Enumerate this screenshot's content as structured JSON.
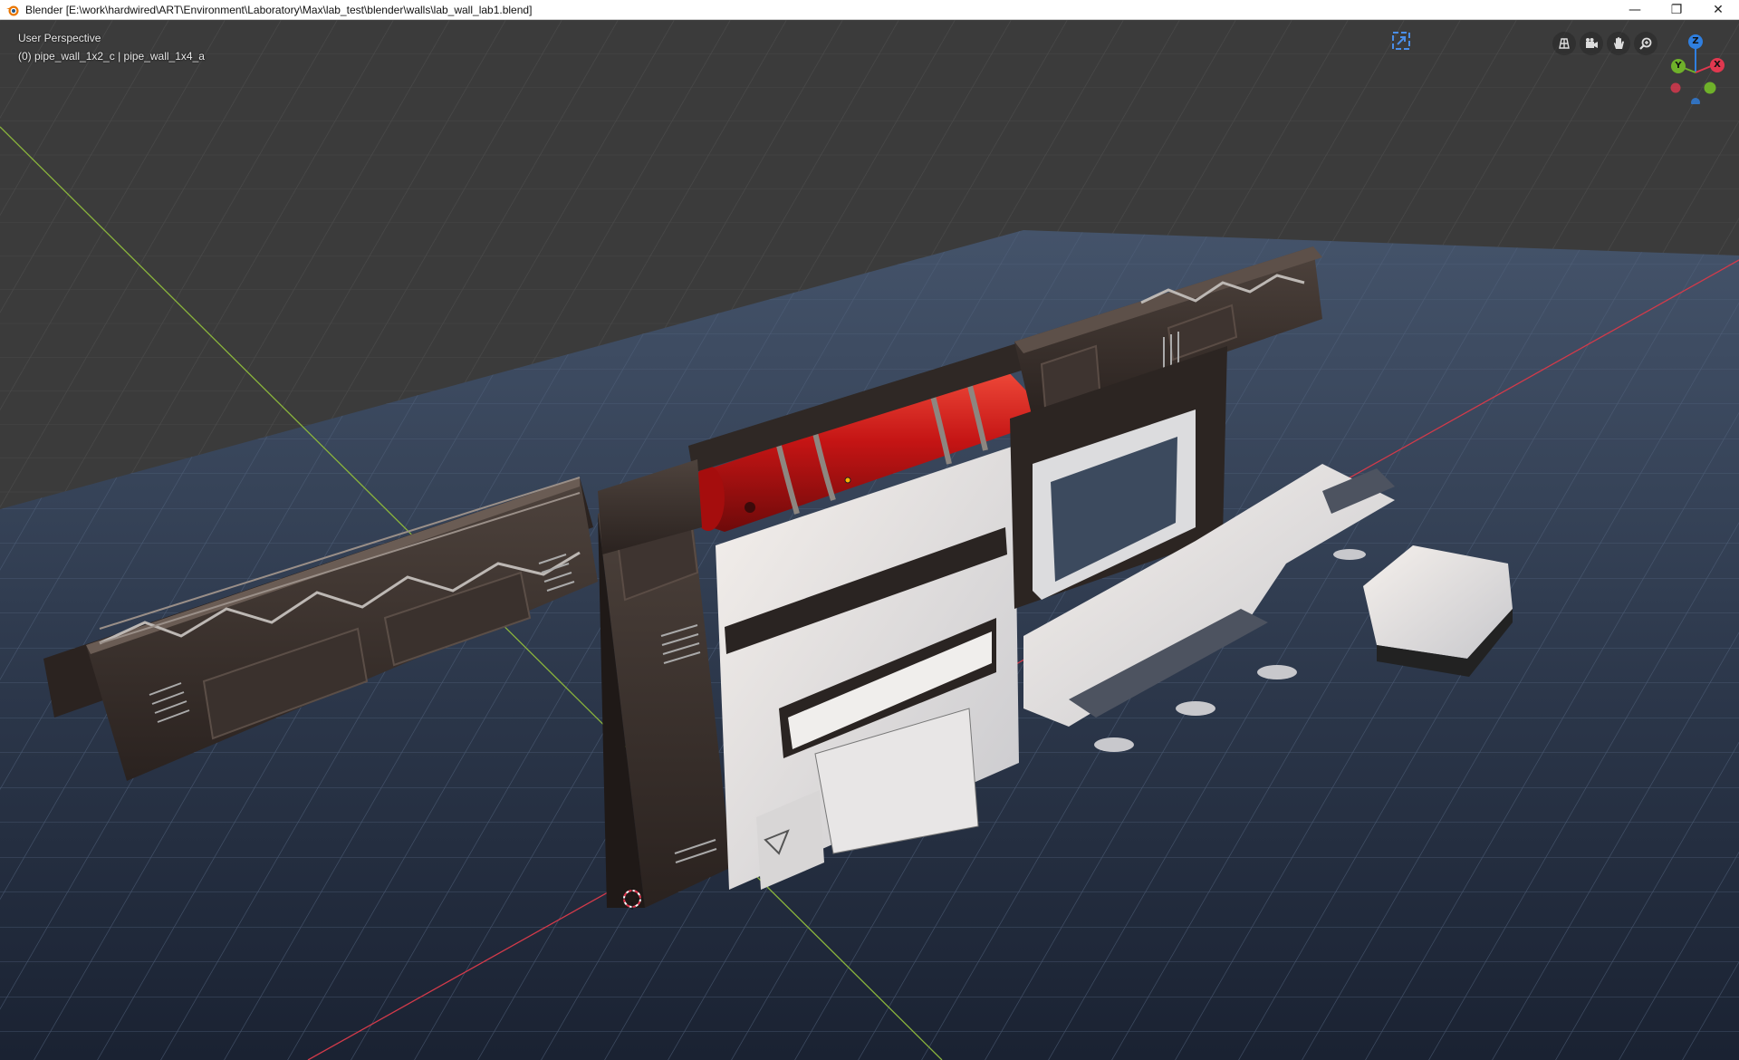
{
  "window": {
    "title": "Blender [E:\\work\\hardwired\\ART\\Environment\\Laboratory\\Max\\lab_test\\blender\\walls\\lab_wall_lab1.blend]",
    "controls": {
      "minimize": "—",
      "restore": "❐",
      "close": "✕"
    }
  },
  "viewport": {
    "view_label": "User Perspective",
    "object_label": "(0) pipe_wall_1x2_c | pipe_wall_1x4_a"
  },
  "navigation": {
    "buttons": [
      "toggle-ortho",
      "camera-view",
      "pan-view",
      "zoom-view"
    ]
  },
  "gizmo": {
    "axes": [
      {
        "label": "Z",
        "color": "#2f7fe0"
      },
      {
        "label": "Y",
        "color": "#6fb12a"
      },
      {
        "label": "X",
        "color": "#e0384f"
      }
    ]
  },
  "colors": {
    "grid_floor": "#3a3a3a",
    "ground_plane": "#2b3a4f",
    "wall_dark": "#3a302b",
    "wall_white": "#e6e4e3",
    "pipe_red": "#c81818",
    "x_axis": "#d23a4a",
    "y_axis": "#8ab43c",
    "accent_blue": "#4a8ee8"
  }
}
